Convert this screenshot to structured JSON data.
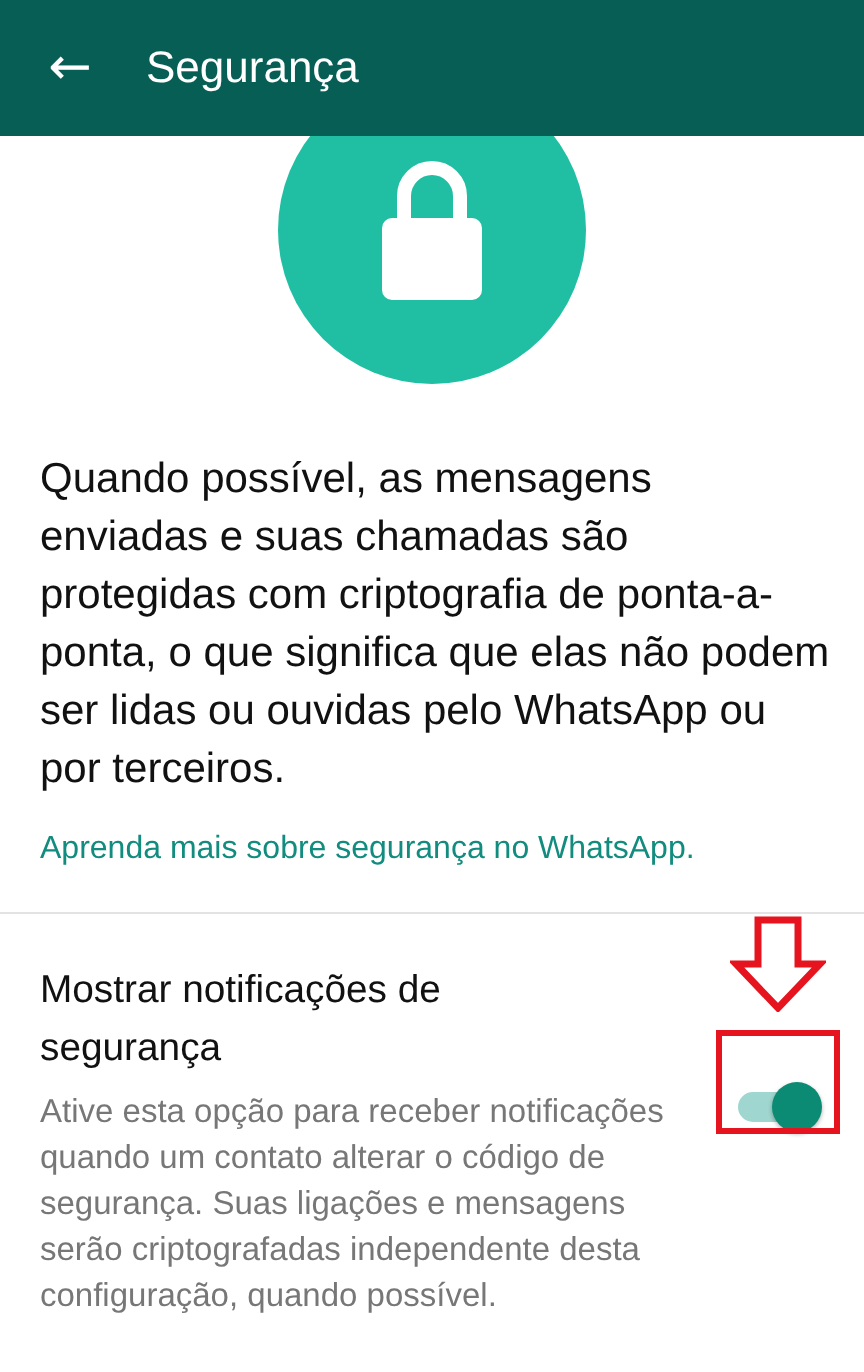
{
  "app_bar": {
    "back": "←",
    "title": "Segurança"
  },
  "hero": {
    "kind": "lock"
  },
  "description": "Quando possível, as mensagens enviadas e suas chamadas são protegidas com criptografia de ponta-a-ponta, o que significa que elas não podem ser lidas ou ouvidas pelo WhatsApp ou por terceiros.",
  "learn_more_link": "Aprenda mais sobre segurança no WhatsApp.",
  "settings": [
    {
      "title": "Mostrar notificações de segurança",
      "summary": "Ative esta opção para receber notificações quando um contato alterar o código de segurança. Suas ligações e mensagens serão criptografadas independente desta configuração, quando possível.",
      "on": true
    }
  ],
  "annotations": [
    {
      "kind": "arrow"
    },
    {
      "kind": "box"
    }
  ]
}
